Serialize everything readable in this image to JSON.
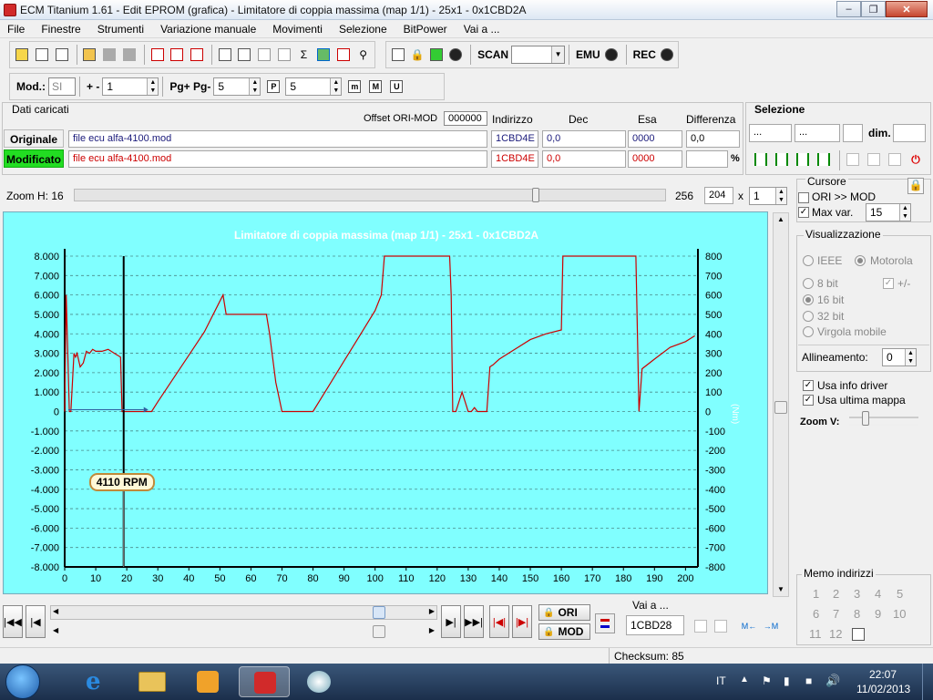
{
  "window": {
    "title": "ECM Titanium 1.61 - Edit EPROM (grafica) - Limitatore di coppia massima (map 1/1) - 25x1 - 0x1CBD2A"
  },
  "menu": [
    "File",
    "Finestre",
    "Strumenti",
    "Variazione manuale",
    "Movimenti",
    "Selezione",
    "BitPower",
    "Vai a ..."
  ],
  "toolbar": {
    "scan_label": "SCAN",
    "emu_label": "EMU",
    "rec_label": "REC",
    "scan_combo": ""
  },
  "toolbar2": {
    "mod_label": "Mod.:",
    "mod_value": "SI",
    "plusminus_label": "+ -",
    "plusminus_value": "1",
    "pg_label": "Pg+ Pg-",
    "pg_value": "5",
    "p_value": "5"
  },
  "dati": {
    "header": "Dati caricati",
    "offset_label": "Offset ORI-MOD",
    "offset_value": "000000",
    "col_indirizzo": "Indirizzo",
    "col_dec": "Dec",
    "col_esa": "Esa",
    "col_diff": "Differenza",
    "originale_label": "Originale",
    "modificato_label": "Modificato",
    "ori_file": "file ecu alfa-4100.mod",
    "mod_file": "file ecu alfa-4100.mod",
    "ori_addr": "1CBD4E",
    "mod_addr": "1CBD4E",
    "ori_dec": "0,0",
    "mod_dec": "0,0",
    "ori_esa": "0000",
    "mod_esa": "0000",
    "ori_diff": "0,0",
    "mod_diff": "",
    "percent": "%"
  },
  "selezione": {
    "header": "Selezione",
    "field1": "...",
    "field2": "...",
    "dim_label": "dim."
  },
  "zoom": {
    "label": "Zoom H: 16",
    "val1": "256",
    "val2": "204",
    "x_label": "x",
    "mult": "1"
  },
  "cursore": {
    "header": "Cursore",
    "ori_mod": "ORI >> MOD",
    "maxvar": "Max var.",
    "maxvar_value": "15"
  },
  "visualizzazione": {
    "header": "Visualizzazione",
    "ieee": "IEEE",
    "motorola": "Motorola",
    "bit8": "8 bit",
    "bit16": "16 bit",
    "bit32": "32 bit",
    "virgola": "Virgola mobile",
    "sign": "+/-",
    "allineamento": "Allineamento:",
    "allineamento_value": "0",
    "usa_info": "Usa info driver",
    "usa_ultima": "Usa ultima mappa",
    "zoomv": "Zoom V:"
  },
  "chart_data": {
    "type": "line",
    "title": "Limitatore di coppia massima (map 1/1) - 25x1 - 0x1CBD2A",
    "ylabel_right": "(Nm)",
    "cursor_label": "4110 RPM",
    "cursor_x": 19,
    "xlim": [
      0,
      204
    ],
    "ylim_left": [
      -8000,
      8000
    ],
    "ylim_right": [
      -800,
      800
    ],
    "x_ticks": [
      "0",
      "10",
      "20",
      "30",
      "40",
      "50",
      "60",
      "70",
      "80",
      "90",
      "100",
      "110",
      "120",
      "130",
      "140",
      "150",
      "160",
      "170",
      "180",
      "190",
      "200"
    ],
    "y_ticks_left": [
      "8.000",
      "7.000",
      "6.000",
      "5.000",
      "4.000",
      "3.000",
      "2.000",
      "1.000",
      "0",
      "-1.000",
      "-2.000",
      "-3.000",
      "-4.000",
      "-5.000",
      "-6.000",
      "-7.000",
      "-8.000"
    ],
    "y_ticks_right": [
      "800",
      "700",
      "600",
      "500",
      "400",
      "300",
      "200",
      "100",
      "0",
      "-100",
      "-200",
      "-300",
      "-400",
      "-500",
      "-600",
      "-700",
      "-800"
    ],
    "series": [
      {
        "color": "#cc0000",
        "x": [
          0,
          0.5,
          1,
          1.5,
          2,
          3,
          3.5,
          4,
          5,
          6,
          7,
          8,
          9,
          10,
          12,
          14,
          16,
          18,
          18.5,
          19,
          20,
          22,
          24,
          26,
          28,
          30,
          35,
          40,
          45,
          51,
          52,
          55,
          60,
          65,
          66,
          68,
          70,
          75,
          80,
          85,
          90,
          95,
          100,
          102,
          103,
          103.5,
          124,
          124.5,
          125,
          126,
          128,
          130,
          131,
          132,
          133,
          134,
          136,
          137,
          138,
          140,
          145,
          150,
          155,
          160,
          160.5,
          162,
          170,
          180,
          184,
          185,
          186,
          190,
          195,
          200,
          203
        ],
        "y": [
          0,
          6000,
          3000,
          0,
          0,
          3000,
          2800,
          3000,
          2300,
          2500,
          3100,
          3000,
          3200,
          3100,
          3100,
          3200,
          3000,
          2800,
          0,
          0,
          0,
          0,
          0,
          0,
          0,
          500,
          1700,
          2900,
          4100,
          6000,
          5000,
          5000,
          5000,
          5000,
          4000,
          1500,
          0,
          0,
          0,
          1300,
          2600,
          3900,
          5200,
          6000,
          9000,
          9000,
          9000,
          6000,
          0,
          0,
          1000,
          0,
          0,
          200,
          0,
          0,
          0,
          2300,
          2400,
          2700,
          3200,
          3700,
          4000,
          4200,
          8200,
          8200,
          8200,
          8200,
          8200,
          0,
          2200,
          2700,
          3300,
          3600,
          3900
        ]
      }
    ]
  },
  "bottom": {
    "ori_label": "ORI",
    "mod_label": "MOD",
    "vai_label": "Vai a ...",
    "vai_value": "1CBD28"
  },
  "memo": {
    "header": "Memo indirizzi",
    "items": [
      "1",
      "2",
      "3",
      "4",
      "5",
      "6",
      "7",
      "8",
      "9",
      "10",
      "11",
      "12"
    ]
  },
  "status": {
    "checksum": "Checksum: 85"
  },
  "taskbar": {
    "lang": "IT",
    "time": "22:07",
    "date": "11/02/2013"
  }
}
